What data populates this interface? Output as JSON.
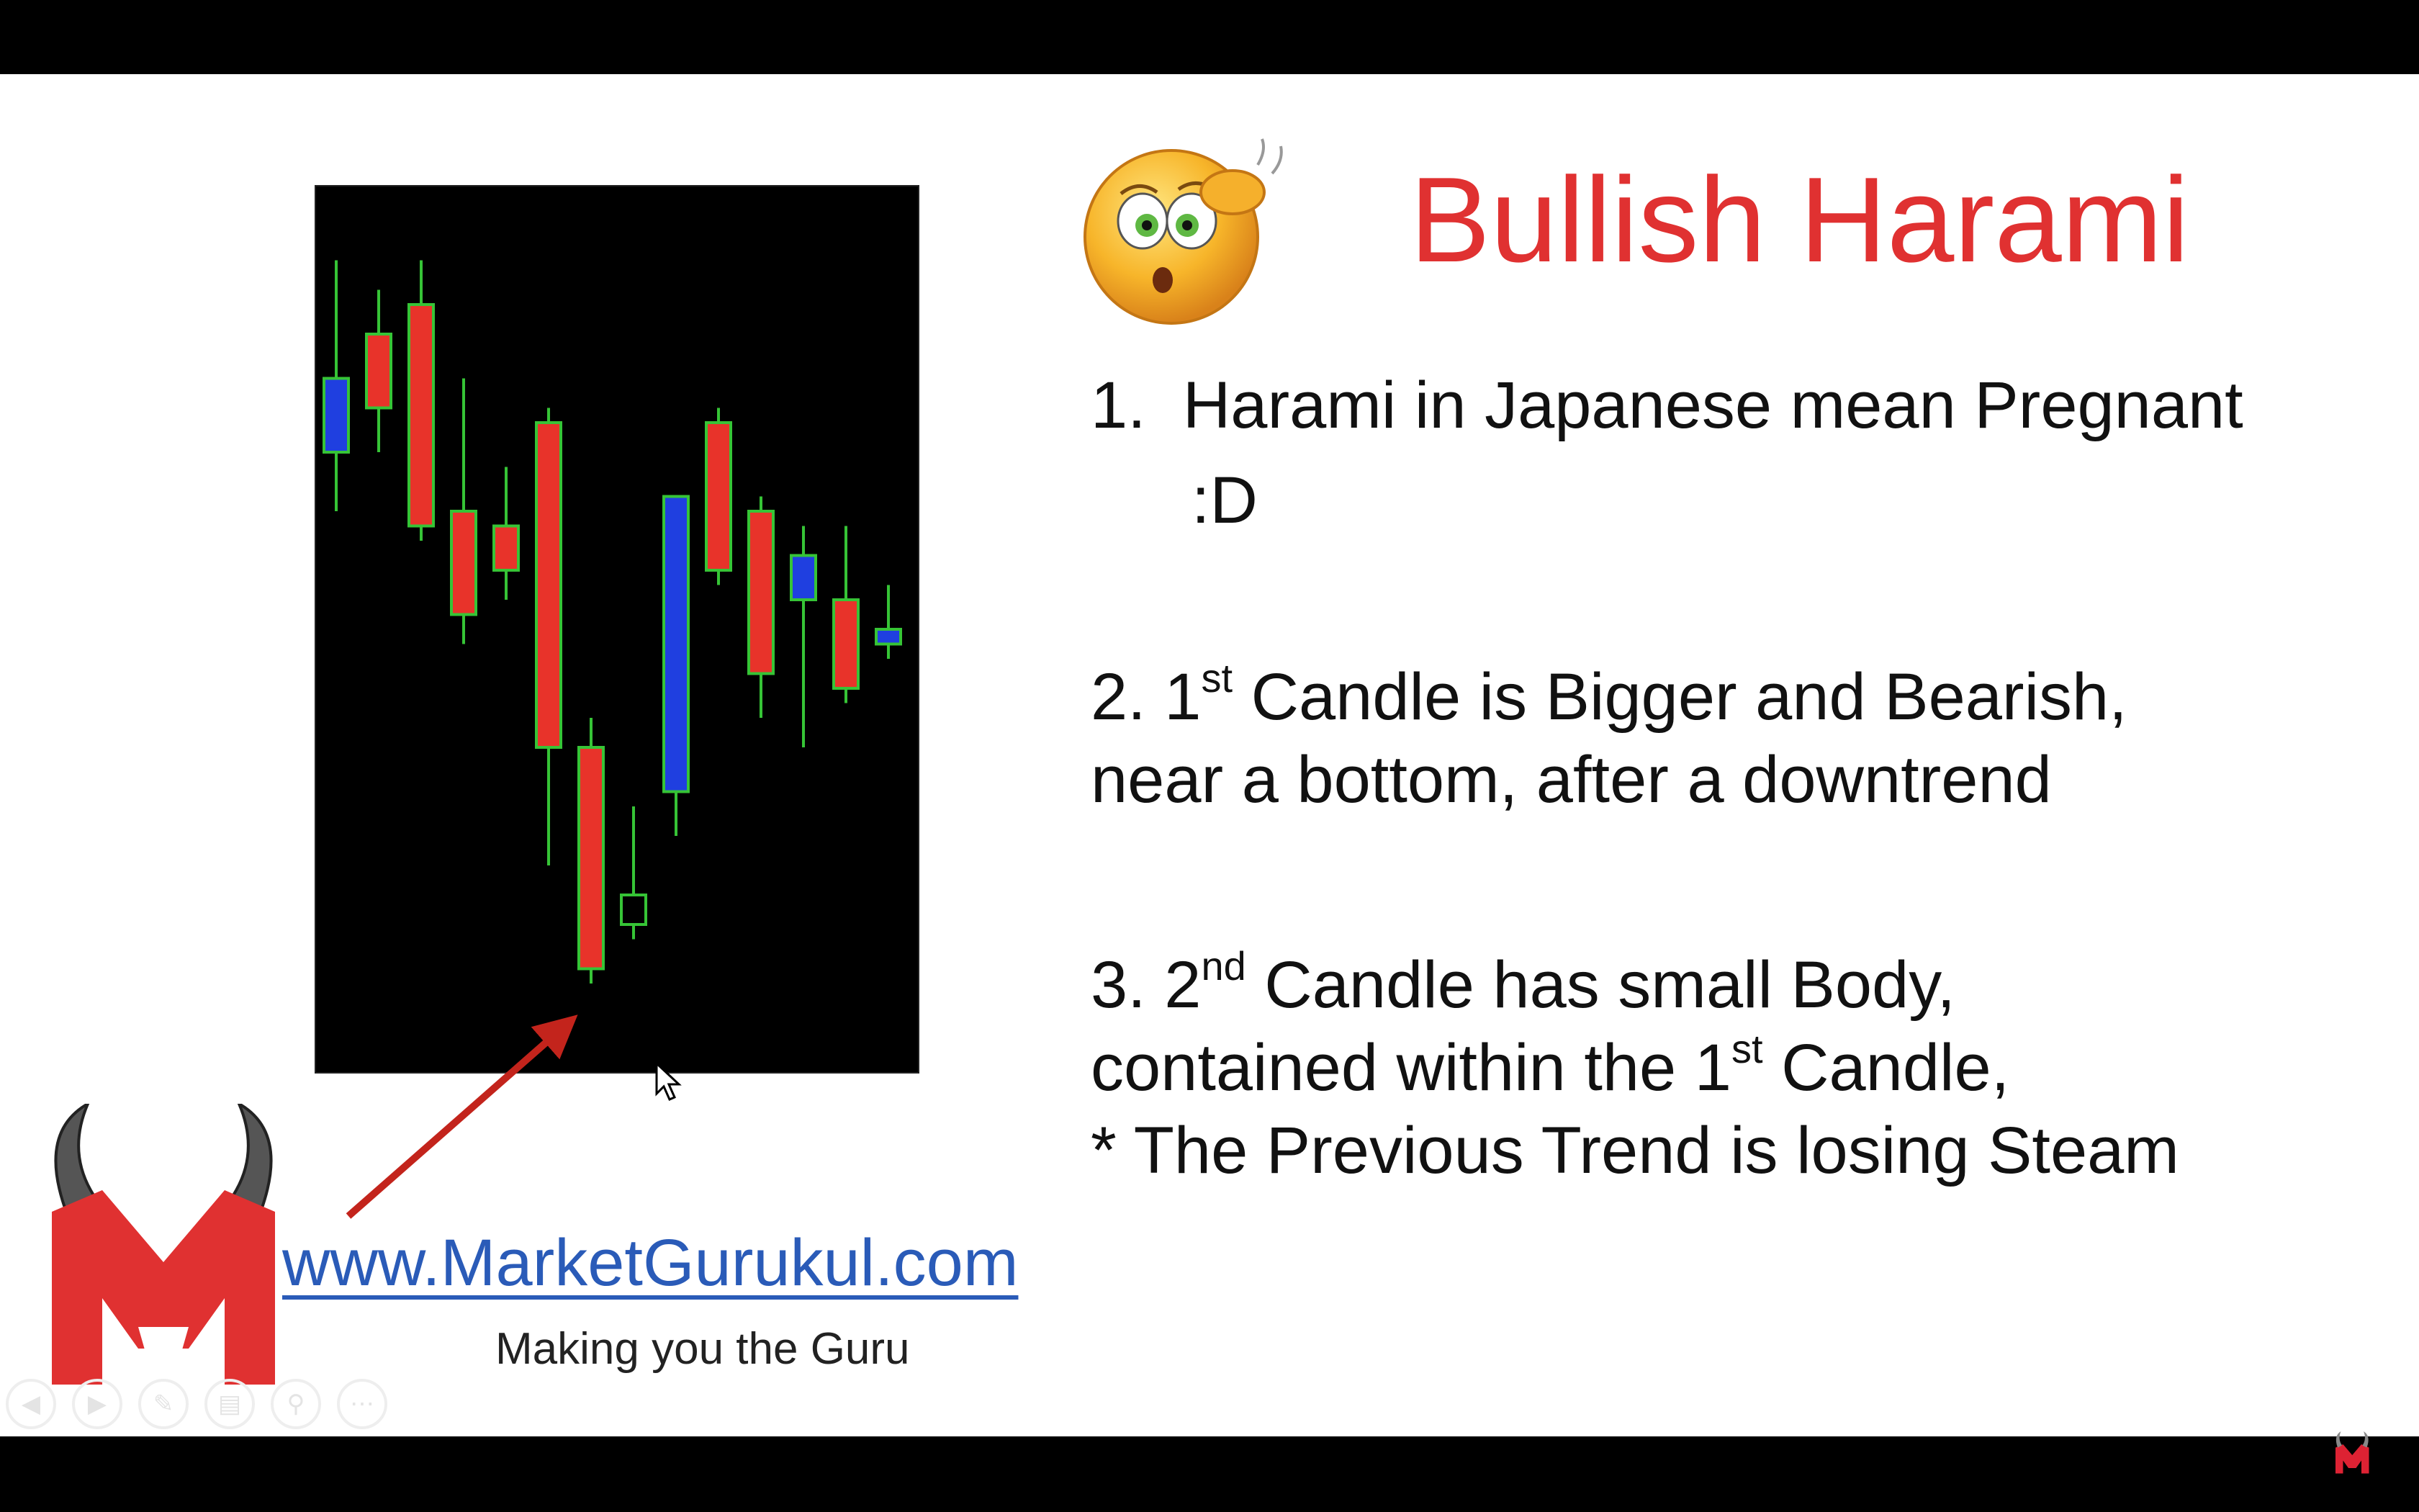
{
  "slide": {
    "title": "Bullish Harami",
    "points": [
      {
        "number": "1.",
        "text": "Harami in Japanese mean Pregnant",
        "continuation": ":D"
      },
      {
        "line1_prefix": "2. 1",
        "line1_sup": "st",
        "line1_suffix": " Candle is Bigger and Bearish,",
        "line2": "near a bottom, after a downtrend"
      },
      {
        "line1_prefix": "3. 2",
        "line1_sup": "nd",
        "line1_suffix": " Candle has small Body,",
        "line2_prefix": "contained within the 1",
        "line2_sup": "st",
        "line2_suffix": " Candle,",
        "line3": "* The Previous Trend is losing Steam"
      }
    ]
  },
  "branding": {
    "url": "www.MarketGurukul.com",
    "tagline": "Making you the Guru"
  },
  "icons": {
    "emoji": "confused-thinking-face-icon",
    "arrow": "red-pointer-arrow-icon",
    "logo": "bull-m-logo-icon",
    "cursor": "mouse-cursor-icon"
  },
  "colors": {
    "title": "#e03131",
    "bear_candle": "#e8332a",
    "bull_candle": "#1f3fe0",
    "wick": "#36c436",
    "url": "#2a5bb8"
  },
  "chart_data": {
    "type": "candlestick",
    "candles": [
      {
        "open": 62,
        "close": 67,
        "high": 75,
        "low": 58,
        "color": "blue"
      },
      {
        "open": 70,
        "close": 65,
        "high": 73,
        "low": 62,
        "color": "red"
      },
      {
        "open": 72,
        "close": 57,
        "high": 75,
        "low": 56,
        "color": "red"
      },
      {
        "open": 58,
        "close": 51,
        "high": 67,
        "low": 49,
        "color": "red"
      },
      {
        "open": 57,
        "close": 54,
        "high": 61,
        "low": 52,
        "color": "red"
      },
      {
        "open": 64,
        "close": 42,
        "high": 65,
        "low": 34,
        "color": "red"
      },
      {
        "open": 42,
        "close": 27,
        "high": 44,
        "low": 26,
        "color": "red"
      },
      {
        "open": 30,
        "close": 32,
        "high": 38,
        "low": 29,
        "color": "red"
      },
      {
        "open": 39,
        "close": 59,
        "high": 59,
        "low": 36,
        "color": "blue"
      },
      {
        "open": 64,
        "close": 54,
        "high": 65,
        "low": 53,
        "color": "red"
      },
      {
        "open": 58,
        "close": 47,
        "high": 59,
        "low": 44,
        "color": "red"
      },
      {
        "open": 52,
        "close": 55,
        "high": 57,
        "low": 42,
        "color": "blue"
      },
      {
        "open": 52,
        "close": 46,
        "high": 57,
        "low": 45,
        "color": "red"
      },
      {
        "open": 49,
        "close": 50,
        "high": 53,
        "low": 48,
        "color": "blue"
      }
    ],
    "ylim": [
      20,
      80
    ]
  },
  "controls": [
    "prev",
    "next",
    "pen",
    "slides",
    "zoom",
    "more"
  ]
}
